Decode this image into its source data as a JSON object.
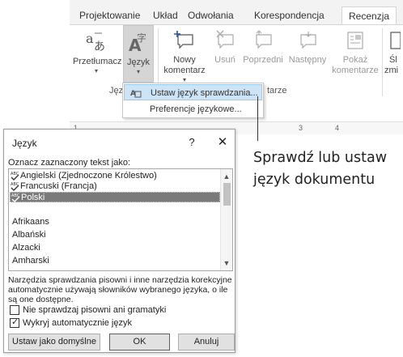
{
  "ribbon": {
    "tabs": [
      "Projektowanie",
      "Układ",
      "Odwołania",
      "Korespondencja",
      "Recenzja"
    ],
    "active_tab": "Recenzja",
    "buttons": {
      "translate": {
        "label": "Przetłumacz",
        "icon": "translate-icon"
      },
      "language": {
        "label": "Język",
        "icon": "language-icon"
      },
      "new_comment": {
        "label": "Nowy komentarz",
        "label_line1": "Nowy",
        "label_line2": "komentarz",
        "icon": "new-comment-icon"
      },
      "delete": {
        "label": "Usuń",
        "icon": "delete-comment-icon"
      },
      "previous": {
        "label": "Poprzedni",
        "icon": "previous-comment-icon"
      },
      "next": {
        "label": "Następny",
        "icon": "next-comment-icon"
      },
      "show_comments": {
        "label": "Pokaż komentarze",
        "label_line1": "Pokaż",
        "label_line2": "komentarze",
        "icon": "show-comments-icon"
      },
      "partial": {
        "label_line1": "Śl",
        "label_line2": "zmi"
      }
    },
    "groups": {
      "language": "Język",
      "comments": "tarze"
    },
    "ruler": {
      "marks": [
        "1",
        "3",
        "4"
      ]
    }
  },
  "language_menu": {
    "items": [
      {
        "label": "Ustaw język sprawdzania...",
        "icon": "set-language-icon",
        "highlighted": true
      },
      {
        "label": "Preferencje językowe...",
        "highlighted": false
      }
    ]
  },
  "callout": {
    "line1": "Sprawdź lub ustaw",
    "line2": "język dokumentu"
  },
  "dialog": {
    "title": "Język",
    "help_label": "?",
    "close_label": "✕",
    "prompt": "Oznacz zaznaczony tekst jako:",
    "languages": [
      {
        "name": "Angielski (Zjednoczone Królestwo)",
        "spellcheck": true,
        "selected": false
      },
      {
        "name": "Francuski (Francja)",
        "spellcheck": true,
        "selected": false
      },
      {
        "name": "Polski",
        "spellcheck": true,
        "selected": true
      },
      {
        "name": "",
        "spellcheck": false,
        "selected": false
      },
      {
        "name": "Afrikaans",
        "spellcheck": false,
        "selected": false
      },
      {
        "name": "Albański",
        "spellcheck": false,
        "selected": false
      },
      {
        "name": "Alzacki",
        "spellcheck": false,
        "selected": false
      },
      {
        "name": "Amharski",
        "spellcheck": false,
        "selected": false
      }
    ],
    "info": "Narzędzia sprawdzania pisowni i inne narzędzia korekcyjne automatycznie używają słowników wybranego języka, o ile są one dostępne.",
    "checkbox_no_spellcheck": {
      "label": "Nie sprawdzaj pisowni ani gramatyki",
      "checked": false
    },
    "checkbox_auto_detect": {
      "label": "Wykryj automatycznie język",
      "checked": true
    },
    "btn_default": "Ustaw jako domyślne",
    "btn_ok": "OK",
    "btn_cancel": "Anuluj"
  },
  "colors": {
    "selection": "#7a7a7a",
    "menu_highlight": "#cde4f7",
    "accent": "#2b579a"
  }
}
